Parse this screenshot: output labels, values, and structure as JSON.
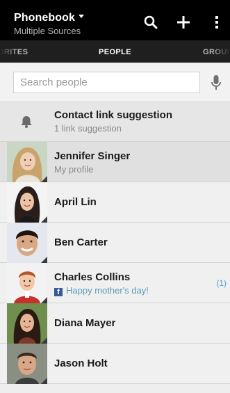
{
  "header": {
    "title": "Phonebook",
    "subtitle": "Multiple Sources",
    "actions": {
      "search": "search-icon",
      "add": "plus-icon",
      "more": "overflow-menu-icon"
    }
  },
  "tabs": {
    "favorites": "ORITES",
    "people": "PEOPLE",
    "groups": "GROUP"
  },
  "search": {
    "placeholder": "Search people"
  },
  "suggestion": {
    "title": "Contact link suggestion",
    "subtitle": "1 link suggestion"
  },
  "contacts": [
    {
      "name": "Jennifer Singer",
      "subtitle": "My profile"
    },
    {
      "name": "April Lin"
    },
    {
      "name": "Ben Carter"
    },
    {
      "name": "Charles Collins",
      "status": "Happy mother's day!",
      "count": "(1)",
      "source_badge": "f"
    },
    {
      "name": "Diana Mayer"
    },
    {
      "name": "Jason Holt"
    }
  ],
  "colors": {
    "actionbar": "#000000",
    "tabbar": "#1f1f1f",
    "accent": "#4a9fd4",
    "facebook": "#3b5998"
  }
}
